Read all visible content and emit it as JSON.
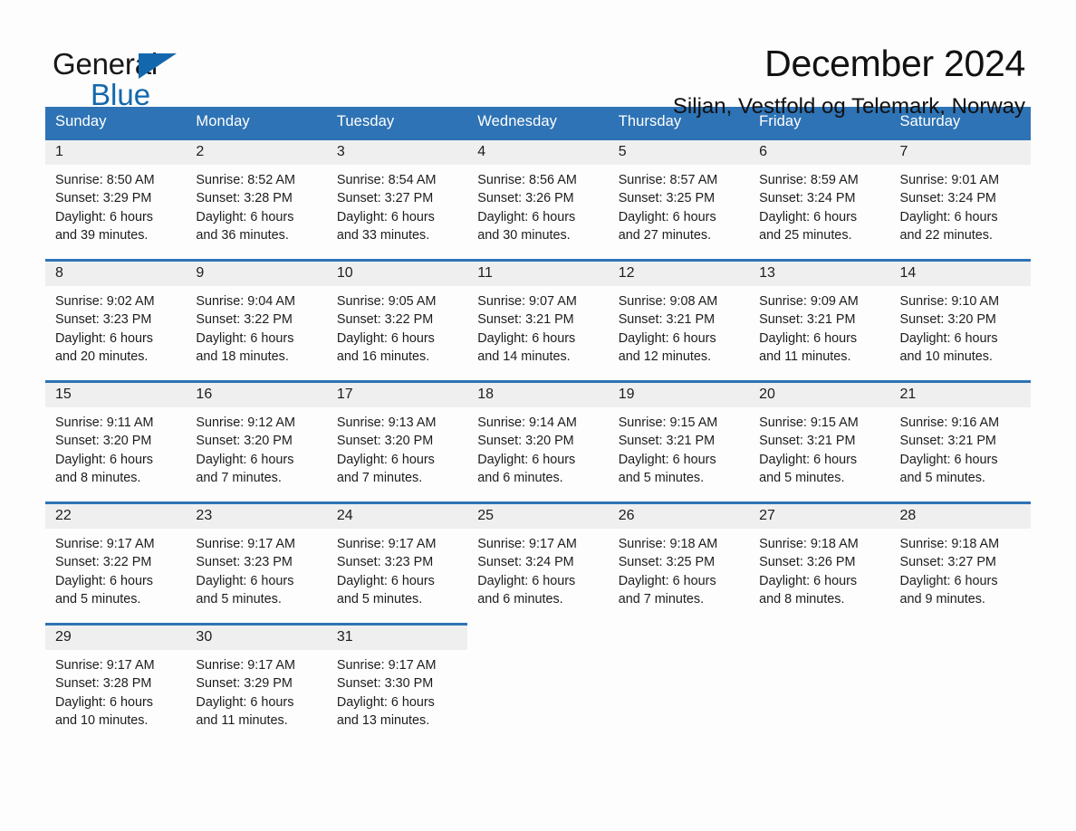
{
  "brand": {
    "name_part1": "General",
    "name_part2": "Blue",
    "logo_icon": "triangle-flag-icon",
    "accent_color": "#1368ad"
  },
  "header": {
    "title": "December 2024",
    "subtitle": "Siljan, Vestfold og Telemark, Norway"
  },
  "theme": {
    "header_row_bg": "#2e73b5",
    "daynum_bg": "#efefef",
    "row_divider": "#2e73b5",
    "text": "#1d1d1d",
    "page_bg": "#fdfdfd"
  },
  "weekdays": [
    "Sunday",
    "Monday",
    "Tuesday",
    "Wednesday",
    "Thursday",
    "Friday",
    "Saturday"
  ],
  "labels": {
    "sunrise_prefix": "Sunrise:",
    "sunset_prefix": "Sunset:",
    "daylight_prefix": "Daylight:"
  },
  "weeks": [
    {
      "days": [
        {
          "date": "1",
          "sunrise": "Sunrise: 8:50 AM",
          "sunset": "Sunset: 3:29 PM",
          "daylight_line1": "Daylight: 6 hours",
          "daylight_line2": "and 39 minutes."
        },
        {
          "date": "2",
          "sunrise": "Sunrise: 8:52 AM",
          "sunset": "Sunset: 3:28 PM",
          "daylight_line1": "Daylight: 6 hours",
          "daylight_line2": "and 36 minutes."
        },
        {
          "date": "3",
          "sunrise": "Sunrise: 8:54 AM",
          "sunset": "Sunset: 3:27 PM",
          "daylight_line1": "Daylight: 6 hours",
          "daylight_line2": "and 33 minutes."
        },
        {
          "date": "4",
          "sunrise": "Sunrise: 8:56 AM",
          "sunset": "Sunset: 3:26 PM",
          "daylight_line1": "Daylight: 6 hours",
          "daylight_line2": "and 30 minutes."
        },
        {
          "date": "5",
          "sunrise": "Sunrise: 8:57 AM",
          "sunset": "Sunset: 3:25 PM",
          "daylight_line1": "Daylight: 6 hours",
          "daylight_line2": "and 27 minutes."
        },
        {
          "date": "6",
          "sunrise": "Sunrise: 8:59 AM",
          "sunset": "Sunset: 3:24 PM",
          "daylight_line1": "Daylight: 6 hours",
          "daylight_line2": "and 25 minutes."
        },
        {
          "date": "7",
          "sunrise": "Sunrise: 9:01 AM",
          "sunset": "Sunset: 3:24 PM",
          "daylight_line1": "Daylight: 6 hours",
          "daylight_line2": "and 22 minutes."
        }
      ]
    },
    {
      "days": [
        {
          "date": "8",
          "sunrise": "Sunrise: 9:02 AM",
          "sunset": "Sunset: 3:23 PM",
          "daylight_line1": "Daylight: 6 hours",
          "daylight_line2": "and 20 minutes."
        },
        {
          "date": "9",
          "sunrise": "Sunrise: 9:04 AM",
          "sunset": "Sunset: 3:22 PM",
          "daylight_line1": "Daylight: 6 hours",
          "daylight_line2": "and 18 minutes."
        },
        {
          "date": "10",
          "sunrise": "Sunrise: 9:05 AM",
          "sunset": "Sunset: 3:22 PM",
          "daylight_line1": "Daylight: 6 hours",
          "daylight_line2": "and 16 minutes."
        },
        {
          "date": "11",
          "sunrise": "Sunrise: 9:07 AM",
          "sunset": "Sunset: 3:21 PM",
          "daylight_line1": "Daylight: 6 hours",
          "daylight_line2": "and 14 minutes."
        },
        {
          "date": "12",
          "sunrise": "Sunrise: 9:08 AM",
          "sunset": "Sunset: 3:21 PM",
          "daylight_line1": "Daylight: 6 hours",
          "daylight_line2": "and 12 minutes."
        },
        {
          "date": "13",
          "sunrise": "Sunrise: 9:09 AM",
          "sunset": "Sunset: 3:21 PM",
          "daylight_line1": "Daylight: 6 hours",
          "daylight_line2": "and 11 minutes."
        },
        {
          "date": "14",
          "sunrise": "Sunrise: 9:10 AM",
          "sunset": "Sunset: 3:20 PM",
          "daylight_line1": "Daylight: 6 hours",
          "daylight_line2": "and 10 minutes."
        }
      ]
    },
    {
      "days": [
        {
          "date": "15",
          "sunrise": "Sunrise: 9:11 AM",
          "sunset": "Sunset: 3:20 PM",
          "daylight_line1": "Daylight: 6 hours",
          "daylight_line2": "and 8 minutes."
        },
        {
          "date": "16",
          "sunrise": "Sunrise: 9:12 AM",
          "sunset": "Sunset: 3:20 PM",
          "daylight_line1": "Daylight: 6 hours",
          "daylight_line2": "and 7 minutes."
        },
        {
          "date": "17",
          "sunrise": "Sunrise: 9:13 AM",
          "sunset": "Sunset: 3:20 PM",
          "daylight_line1": "Daylight: 6 hours",
          "daylight_line2": "and 7 minutes."
        },
        {
          "date": "18",
          "sunrise": "Sunrise: 9:14 AM",
          "sunset": "Sunset: 3:20 PM",
          "daylight_line1": "Daylight: 6 hours",
          "daylight_line2": "and 6 minutes."
        },
        {
          "date": "19",
          "sunrise": "Sunrise: 9:15 AM",
          "sunset": "Sunset: 3:21 PM",
          "daylight_line1": "Daylight: 6 hours",
          "daylight_line2": "and 5 minutes."
        },
        {
          "date": "20",
          "sunrise": "Sunrise: 9:15 AM",
          "sunset": "Sunset: 3:21 PM",
          "daylight_line1": "Daylight: 6 hours",
          "daylight_line2": "and 5 minutes."
        },
        {
          "date": "21",
          "sunrise": "Sunrise: 9:16 AM",
          "sunset": "Sunset: 3:21 PM",
          "daylight_line1": "Daylight: 6 hours",
          "daylight_line2": "and 5 minutes."
        }
      ]
    },
    {
      "days": [
        {
          "date": "22",
          "sunrise": "Sunrise: 9:17 AM",
          "sunset": "Sunset: 3:22 PM",
          "daylight_line1": "Daylight: 6 hours",
          "daylight_line2": "and 5 minutes."
        },
        {
          "date": "23",
          "sunrise": "Sunrise: 9:17 AM",
          "sunset": "Sunset: 3:23 PM",
          "daylight_line1": "Daylight: 6 hours",
          "daylight_line2": "and 5 minutes."
        },
        {
          "date": "24",
          "sunrise": "Sunrise: 9:17 AM",
          "sunset": "Sunset: 3:23 PM",
          "daylight_line1": "Daylight: 6 hours",
          "daylight_line2": "and 5 minutes."
        },
        {
          "date": "25",
          "sunrise": "Sunrise: 9:17 AM",
          "sunset": "Sunset: 3:24 PM",
          "daylight_line1": "Daylight: 6 hours",
          "daylight_line2": "and 6 minutes."
        },
        {
          "date": "26",
          "sunrise": "Sunrise: 9:18 AM",
          "sunset": "Sunset: 3:25 PM",
          "daylight_line1": "Daylight: 6 hours",
          "daylight_line2": "and 7 minutes."
        },
        {
          "date": "27",
          "sunrise": "Sunrise: 9:18 AM",
          "sunset": "Sunset: 3:26 PM",
          "daylight_line1": "Daylight: 6 hours",
          "daylight_line2": "and 8 minutes."
        },
        {
          "date": "28",
          "sunrise": "Sunrise: 9:18 AM",
          "sunset": "Sunset: 3:27 PM",
          "daylight_line1": "Daylight: 6 hours",
          "daylight_line2": "and 9 minutes."
        }
      ]
    },
    {
      "days": [
        {
          "date": "29",
          "sunrise": "Sunrise: 9:17 AM",
          "sunset": "Sunset: 3:28 PM",
          "daylight_line1": "Daylight: 6 hours",
          "daylight_line2": "and 10 minutes."
        },
        {
          "date": "30",
          "sunrise": "Sunrise: 9:17 AM",
          "sunset": "Sunset: 3:29 PM",
          "daylight_line1": "Daylight: 6 hours",
          "daylight_line2": "and 11 minutes."
        },
        {
          "date": "31",
          "sunrise": "Sunrise: 9:17 AM",
          "sunset": "Sunset: 3:30 PM",
          "daylight_line1": "Daylight: 6 hours",
          "daylight_line2": "and 13 minutes."
        },
        {
          "date": "",
          "sunrise": "",
          "sunset": "",
          "daylight_line1": "",
          "daylight_line2": "",
          "empty": true
        },
        {
          "date": "",
          "sunrise": "",
          "sunset": "",
          "daylight_line1": "",
          "daylight_line2": "",
          "empty": true
        },
        {
          "date": "",
          "sunrise": "",
          "sunset": "",
          "daylight_line1": "",
          "daylight_line2": "",
          "empty": true
        },
        {
          "date": "",
          "sunrise": "",
          "sunset": "",
          "daylight_line1": "",
          "daylight_line2": "",
          "empty": true
        }
      ]
    }
  ]
}
